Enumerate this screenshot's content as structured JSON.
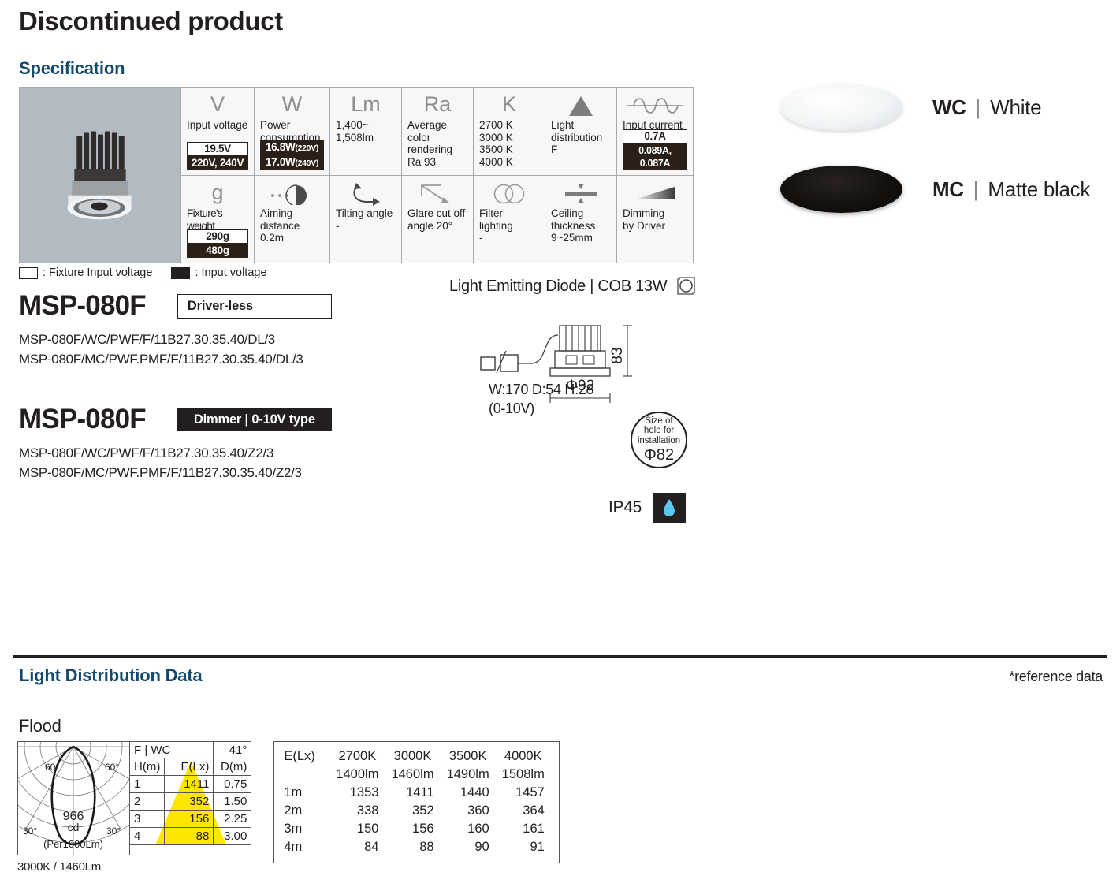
{
  "page": {
    "title": "Discontinued product",
    "spec_heading": "Specification",
    "ldd_heading": "Light Distribution Data",
    "reference_note": "*reference data",
    "flood_label": "Flood"
  },
  "spec_table": {
    "row1": [
      {
        "glyph": "V",
        "icon": "voltage-icon",
        "label": "Input voltage",
        "badge_white": "19.5V",
        "badge_black": "220V, 240V"
      },
      {
        "glyph": "W",
        "icon": "wattage-icon",
        "label": "Power\nconsumption",
        "badge_black_1": "16.8W",
        "badge_black_1_sm": "(220V)",
        "badge_black_2": "17.0W",
        "badge_black_2_sm": "(240V)"
      },
      {
        "glyph": "Lm",
        "icon": "lumen-icon",
        "label": "1,400~\n1,508lm"
      },
      {
        "glyph": "Ra",
        "icon": "cri-icon",
        "label": "Average color\nrendering\nRa 93"
      },
      {
        "glyph": "K",
        "icon": "kelvin-icon",
        "label": "2700 K\n3000 K\n3500 K\n4000 K"
      },
      {
        "glyph": "",
        "icon": "beam-triangle-icon",
        "label": "Light\ndistribution\nF"
      },
      {
        "glyph": "",
        "icon": "ac-waveform-icon",
        "label": "Input current",
        "badge_white": "0.7A",
        "badge_black": "0.089A, 0.087A"
      }
    ],
    "row2": [
      {
        "glyph": "g",
        "icon": "weight-icon",
        "label": "Fixture's weight",
        "badge_white": "290g",
        "badge_black": "480g"
      },
      {
        "glyph": "",
        "icon": "aiming-distance-icon",
        "label": "Aiming\ndistance\n0.2m"
      },
      {
        "glyph": "",
        "icon": "tilting-angle-icon",
        "label": "Tilting angle\n-"
      },
      {
        "glyph": "",
        "icon": "glare-cutoff-icon",
        "label": "Glare cut off\nangle 20°"
      },
      {
        "glyph": "",
        "icon": "filter-lighting-icon",
        "label": "Filter lighting\n-"
      },
      {
        "glyph": "",
        "icon": "ceiling-thickness-icon",
        "label": "Ceiling\nthickness\n9~25mm"
      },
      {
        "glyph": "",
        "icon": "dimming-icon",
        "label": "Dimming\nby Driver"
      }
    ]
  },
  "legend": {
    "fixture_input_voltage": ": Fixture Input voltage",
    "input_voltage": ": Input voltage"
  },
  "models": [
    {
      "name": "MSP-080F",
      "tag": "Driver-less",
      "tag_style": "outline",
      "codes": [
        "MSP-080F/WC/PWF/F/11B27.30.35.40/DL/3",
        "MSP-080F/MC/PWF.PMF/F/11B27.30.35.40/DL/3"
      ]
    },
    {
      "name": "MSP-080F",
      "tag": "Dimmer | 0-10V type",
      "tag_style": "filled",
      "codes": [
        "MSP-080F/WC/PWF/F/11B27.30.35.40/Z2/3",
        "MSP-080F/MC/PWF.PMF/F/11B27.30.35.40/Z2/3"
      ]
    }
  ],
  "colors": [
    {
      "code": "WC",
      "separator": "|",
      "name": "White"
    },
    {
      "code": "MC",
      "separator": "|",
      "name": "Matte black"
    }
  ],
  "led": {
    "text": "Light Emitting Diode | COB 13W",
    "icon": "cob-module-icon"
  },
  "dimensions": {
    "height_label": "83",
    "diameter_label": "Φ92",
    "driver_caption_line1": "W:170 D:54 H:28",
    "driver_caption_line2": "(0-10V)",
    "hole_line1": "Size of",
    "hole_line2": "hole for",
    "hole_line3": "installation",
    "hole_size": "Φ82",
    "ip_rating": "IP45",
    "ip_icon": "water-drop-icon"
  },
  "chart_data": {
    "type": "table",
    "title": "Light Distribution Data",
    "subtitle": "Flood",
    "polar": {
      "caption": "3000K / 1460Lm",
      "center_value": "966",
      "center_unit": "cd",
      "per_label": "(Per1000Lm)",
      "angle_labels": [
        "60°",
        "60°",
        "30°",
        "30°"
      ]
    },
    "beam_table": {
      "header_left": "F | WC",
      "header_right": "41°",
      "columns": [
        "H(m)",
        "E(Lx)",
        "D(m)"
      ],
      "rows": [
        [
          "1",
          "1411",
          "0.75"
        ],
        [
          "2",
          "352",
          "1.50"
        ],
        [
          "3",
          "156",
          "2.25"
        ],
        [
          "4",
          "88",
          "3.00"
        ]
      ]
    },
    "illuminance_table": {
      "corner": "E(Lx)",
      "columns": [
        "2700K",
        "3000K",
        "3500K",
        "4000K"
      ],
      "column_lumens": [
        "1400lm",
        "1460lm",
        "1490lm",
        "1508lm"
      ],
      "rows": [
        "1m",
        "2m",
        "3m",
        "4m"
      ],
      "values": [
        [
          1353,
          1411,
          1440,
          1457
        ],
        [
          338,
          352,
          360,
          364
        ],
        [
          150,
          156,
          160,
          161
        ],
        [
          84,
          88,
          90,
          91
        ]
      ]
    }
  },
  "theme": {
    "accent": "#144a6e",
    "ink": "#231f20",
    "badge_dark": "#2b2018",
    "photo_bg": "#b2bac2",
    "cell_bg": "#f7f7f7",
    "beam_yellow": "#ffe600",
    "water_blue": "#5bc8f0"
  }
}
